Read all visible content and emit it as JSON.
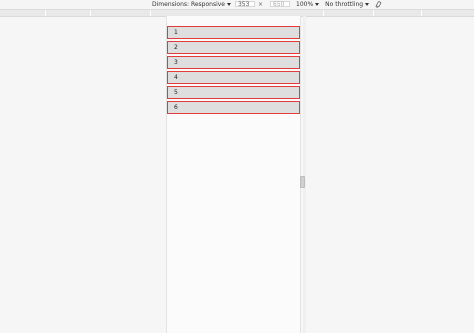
{
  "toolbar": {
    "dimensions_label": "Dimensions: Responsive",
    "width_value": "353",
    "times": "×",
    "height_value": "650",
    "zoom": "100%",
    "throttle": "No throttling",
    "rotate_icon": "rotate-icon"
  },
  "rows": [
    "1",
    "2",
    "3",
    "4",
    "5",
    "6"
  ],
  "colors": {
    "row_border": "#e23b3b",
    "row_fill": "#dedede"
  }
}
